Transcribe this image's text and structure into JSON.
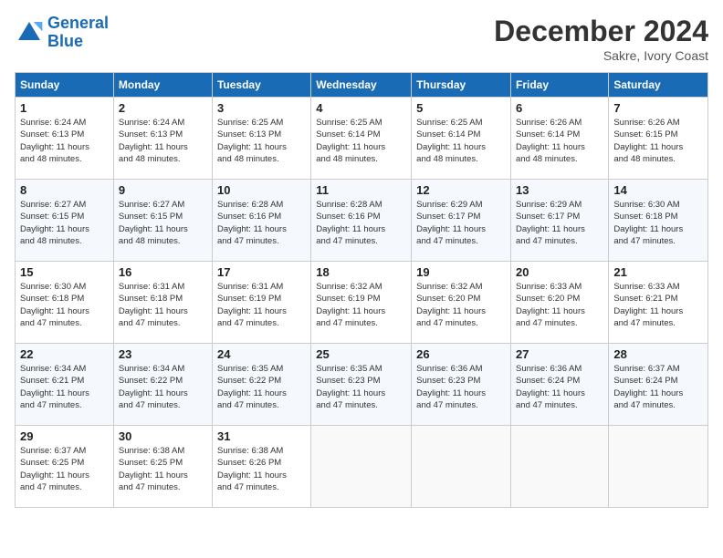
{
  "header": {
    "logo_line1": "General",
    "logo_line2": "Blue",
    "month_title": "December 2024",
    "location": "Sakre, Ivory Coast"
  },
  "weekdays": [
    "Sunday",
    "Monday",
    "Tuesday",
    "Wednesday",
    "Thursday",
    "Friday",
    "Saturday"
  ],
  "weeks": [
    [
      {
        "day": "1",
        "info": "Sunrise: 6:24 AM\nSunset: 6:13 PM\nDaylight: 11 hours\nand 48 minutes."
      },
      {
        "day": "2",
        "info": "Sunrise: 6:24 AM\nSunset: 6:13 PM\nDaylight: 11 hours\nand 48 minutes."
      },
      {
        "day": "3",
        "info": "Sunrise: 6:25 AM\nSunset: 6:13 PM\nDaylight: 11 hours\nand 48 minutes."
      },
      {
        "day": "4",
        "info": "Sunrise: 6:25 AM\nSunset: 6:14 PM\nDaylight: 11 hours\nand 48 minutes."
      },
      {
        "day": "5",
        "info": "Sunrise: 6:25 AM\nSunset: 6:14 PM\nDaylight: 11 hours\nand 48 minutes."
      },
      {
        "day": "6",
        "info": "Sunrise: 6:26 AM\nSunset: 6:14 PM\nDaylight: 11 hours\nand 48 minutes."
      },
      {
        "day": "7",
        "info": "Sunrise: 6:26 AM\nSunset: 6:15 PM\nDaylight: 11 hours\nand 48 minutes."
      }
    ],
    [
      {
        "day": "8",
        "info": "Sunrise: 6:27 AM\nSunset: 6:15 PM\nDaylight: 11 hours\nand 48 minutes."
      },
      {
        "day": "9",
        "info": "Sunrise: 6:27 AM\nSunset: 6:15 PM\nDaylight: 11 hours\nand 48 minutes."
      },
      {
        "day": "10",
        "info": "Sunrise: 6:28 AM\nSunset: 6:16 PM\nDaylight: 11 hours\nand 47 minutes."
      },
      {
        "day": "11",
        "info": "Sunrise: 6:28 AM\nSunset: 6:16 PM\nDaylight: 11 hours\nand 47 minutes."
      },
      {
        "day": "12",
        "info": "Sunrise: 6:29 AM\nSunset: 6:17 PM\nDaylight: 11 hours\nand 47 minutes."
      },
      {
        "day": "13",
        "info": "Sunrise: 6:29 AM\nSunset: 6:17 PM\nDaylight: 11 hours\nand 47 minutes."
      },
      {
        "day": "14",
        "info": "Sunrise: 6:30 AM\nSunset: 6:18 PM\nDaylight: 11 hours\nand 47 minutes."
      }
    ],
    [
      {
        "day": "15",
        "info": "Sunrise: 6:30 AM\nSunset: 6:18 PM\nDaylight: 11 hours\nand 47 minutes."
      },
      {
        "day": "16",
        "info": "Sunrise: 6:31 AM\nSunset: 6:18 PM\nDaylight: 11 hours\nand 47 minutes."
      },
      {
        "day": "17",
        "info": "Sunrise: 6:31 AM\nSunset: 6:19 PM\nDaylight: 11 hours\nand 47 minutes."
      },
      {
        "day": "18",
        "info": "Sunrise: 6:32 AM\nSunset: 6:19 PM\nDaylight: 11 hours\nand 47 minutes."
      },
      {
        "day": "19",
        "info": "Sunrise: 6:32 AM\nSunset: 6:20 PM\nDaylight: 11 hours\nand 47 minutes."
      },
      {
        "day": "20",
        "info": "Sunrise: 6:33 AM\nSunset: 6:20 PM\nDaylight: 11 hours\nand 47 minutes."
      },
      {
        "day": "21",
        "info": "Sunrise: 6:33 AM\nSunset: 6:21 PM\nDaylight: 11 hours\nand 47 minutes."
      }
    ],
    [
      {
        "day": "22",
        "info": "Sunrise: 6:34 AM\nSunset: 6:21 PM\nDaylight: 11 hours\nand 47 minutes."
      },
      {
        "day": "23",
        "info": "Sunrise: 6:34 AM\nSunset: 6:22 PM\nDaylight: 11 hours\nand 47 minutes."
      },
      {
        "day": "24",
        "info": "Sunrise: 6:35 AM\nSunset: 6:22 PM\nDaylight: 11 hours\nand 47 minutes."
      },
      {
        "day": "25",
        "info": "Sunrise: 6:35 AM\nSunset: 6:23 PM\nDaylight: 11 hours\nand 47 minutes."
      },
      {
        "day": "26",
        "info": "Sunrise: 6:36 AM\nSunset: 6:23 PM\nDaylight: 11 hours\nand 47 minutes."
      },
      {
        "day": "27",
        "info": "Sunrise: 6:36 AM\nSunset: 6:24 PM\nDaylight: 11 hours\nand 47 minutes."
      },
      {
        "day": "28",
        "info": "Sunrise: 6:37 AM\nSunset: 6:24 PM\nDaylight: 11 hours\nand 47 minutes."
      }
    ],
    [
      {
        "day": "29",
        "info": "Sunrise: 6:37 AM\nSunset: 6:25 PM\nDaylight: 11 hours\nand 47 minutes."
      },
      {
        "day": "30",
        "info": "Sunrise: 6:38 AM\nSunset: 6:25 PM\nDaylight: 11 hours\nand 47 minutes."
      },
      {
        "day": "31",
        "info": "Sunrise: 6:38 AM\nSunset: 6:26 PM\nDaylight: 11 hours\nand 47 minutes."
      },
      null,
      null,
      null,
      null
    ]
  ]
}
